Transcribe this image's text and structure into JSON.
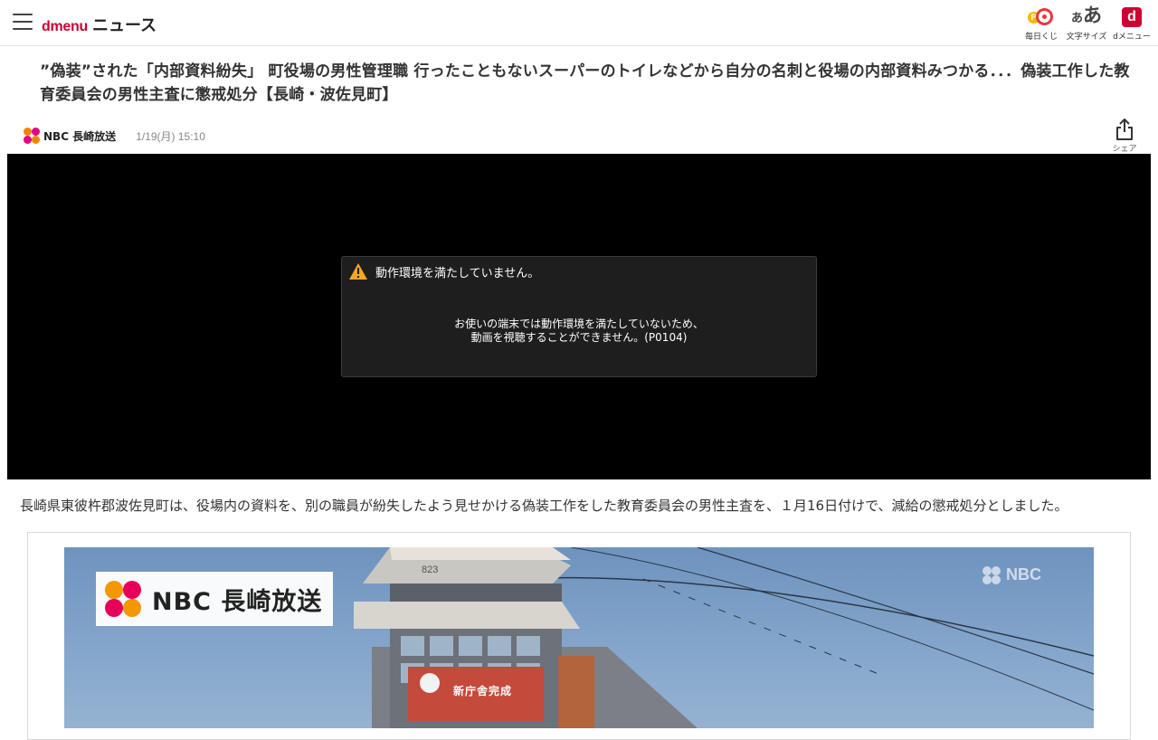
{
  "header": {
    "logo_brand": "dmenu",
    "logo_section": "ニュース",
    "tools": [
      {
        "label": "毎日くじ",
        "icon": "lottery-icon"
      },
      {
        "label": "文字サイズ",
        "icon": "text-size-icon",
        "glyph_small": "あ",
        "glyph_large": "あ"
      },
      {
        "label": "dメニュー",
        "icon": "dmenu-icon",
        "glyph": "d"
      }
    ]
  },
  "article": {
    "title": "”偽装”された「内部資料紛失」 町役場の男性管理職 行ったこともないスーパーのトイレなどから自分の名刺と役場の内部資料みつかる．．．偽装工作した教育委員会の男性主査に懲戒処分【長崎・波佐見町】",
    "source_name": "NBC 長崎放送",
    "date": "1/19(月) 15:10",
    "share_label": "シェア",
    "lead": "長崎県東彼杵郡波佐見町は、役場内の資料を、別の職員が紛失したよう見せかける偽装工作をした教育委員会の男性主査を、１月16日付けで、減給の懲戒処分としました。"
  },
  "video_error": {
    "title": "動作環境を満たしていません。",
    "message_line1": "お使いの端末では動作環境を満たしていないため、",
    "message_line2": "動画を視聴することができません。(P0104)"
  },
  "figure": {
    "banner_text": "NBC 長崎放送",
    "watermark": "NBC",
    "building_sign": "新庁舎完成"
  },
  "colors": {
    "brand_red": "#cc0033",
    "nbc_orange": "#f39800",
    "nbc_pink": "#e6005a",
    "warning_yellow": "#f5a623"
  }
}
